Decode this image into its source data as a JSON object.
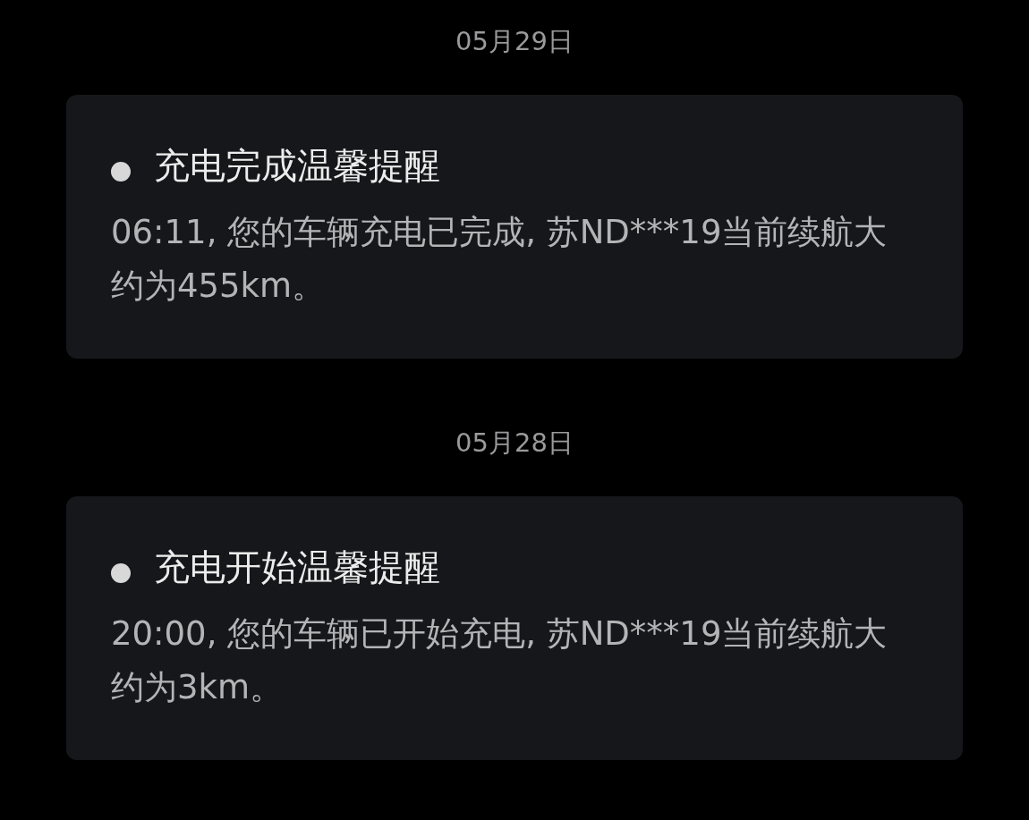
{
  "messages": [
    {
      "date": "05月29日",
      "title": "充电完成温馨提醒",
      "body": "06:11, 您的车辆充电已完成, 苏ND***19当前续航大约为455km。"
    },
    {
      "date": "05月28日",
      "title": "充电开始温馨提醒",
      "body": "20:00, 您的车辆已开始充电, 苏ND***19当前续航大约为3km。"
    }
  ]
}
